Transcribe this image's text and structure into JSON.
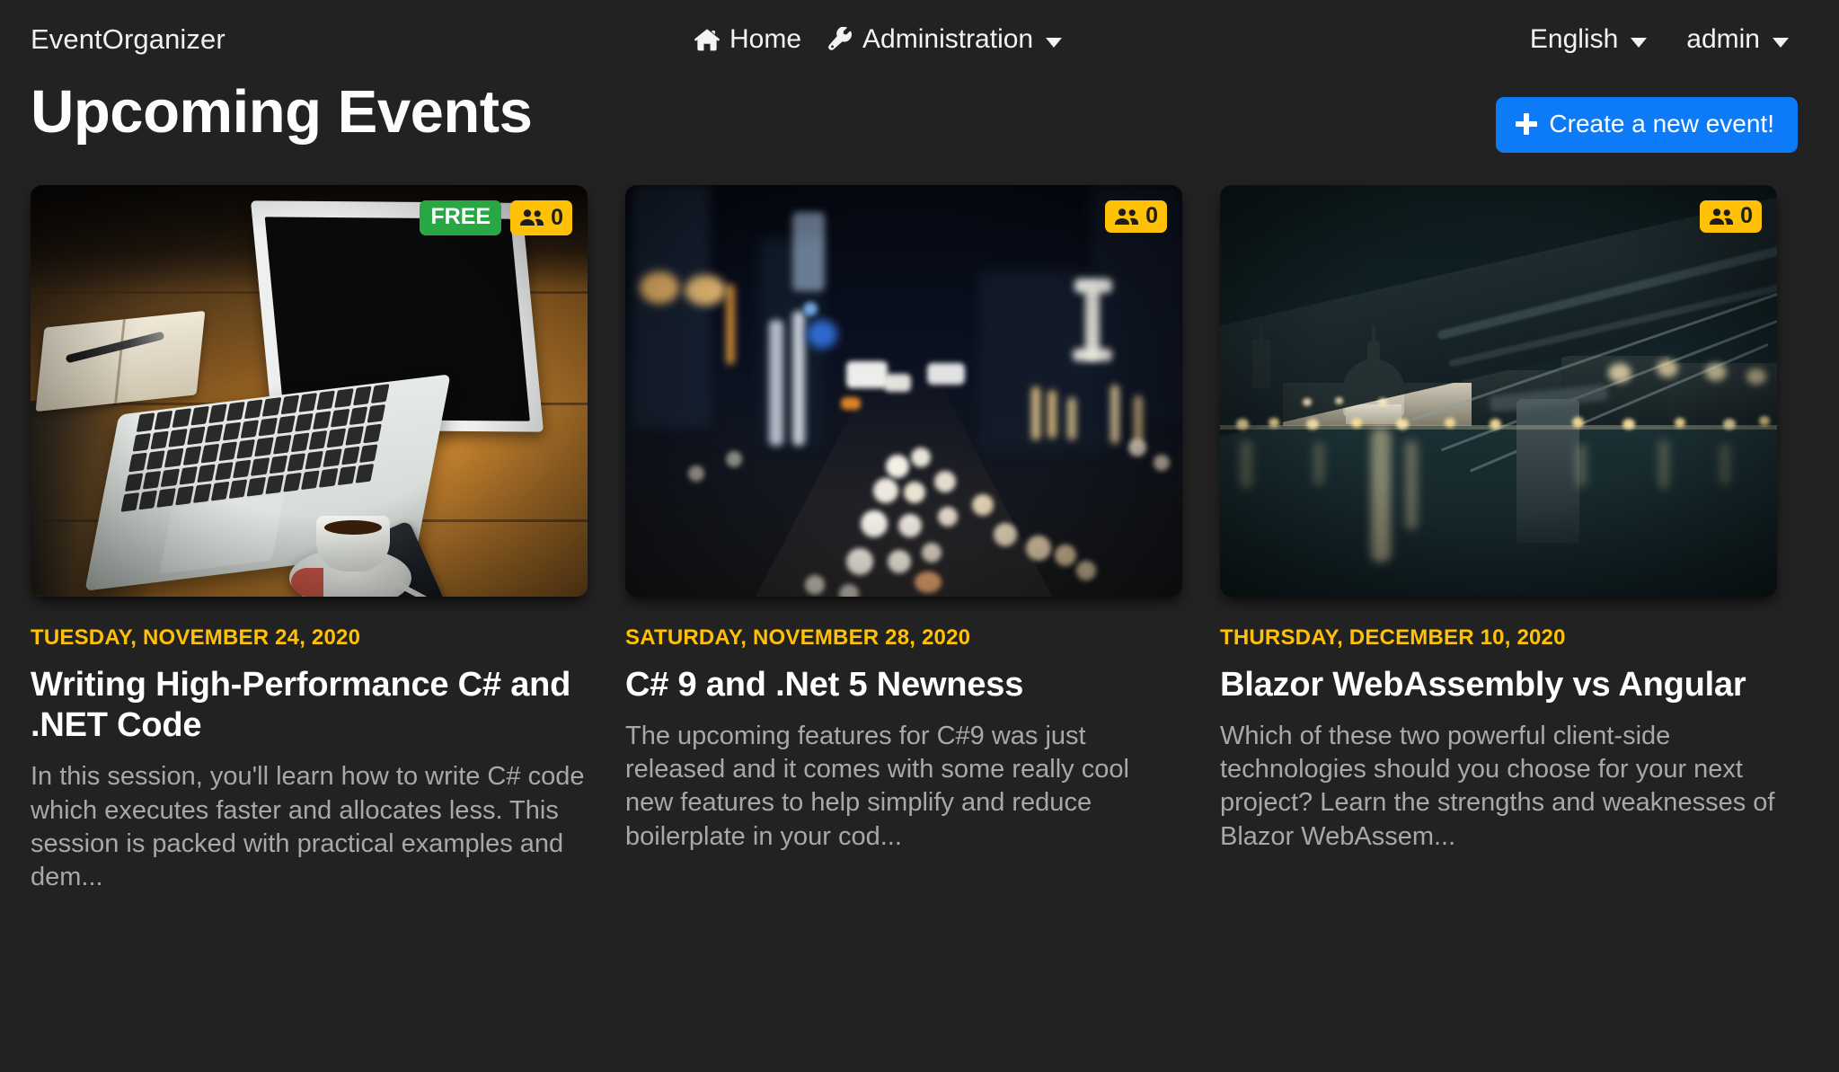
{
  "navbar": {
    "brand": "EventOrganizer",
    "home_label": "Home",
    "home_icon": "home-icon",
    "admin_label": "Administration",
    "admin_icon": "wrench-icon",
    "language_label": "English",
    "user_label": "admin"
  },
  "header": {
    "title": "Upcoming Events",
    "create_button_label": "Create a new event!",
    "create_button_icon": "plus-icon",
    "create_button_color": "#0d7bf7"
  },
  "colors": {
    "page_background": "#222222",
    "date_accent": "#ffc107",
    "free_badge": "#28a745",
    "attendee_badge": "#ffc107",
    "title_text": "#ffffff",
    "body_text": "#a8a8a8"
  },
  "events": [
    {
      "date": "TUESDAY, NOVEMBER 24, 2020",
      "title": "Writing High-Performance C# and .NET Code",
      "description": "In this session, you'll learn how to write C# code which executes faster and allocates less. This session is packed with practical examples and dem...",
      "free_badge": "FREE",
      "attendees": "0",
      "attendee_icon": "people-icon",
      "image_alt": "laptop-notebook-coffee-on-wooden-desk"
    },
    {
      "date": "SATURDAY, NOVEMBER 28, 2020",
      "title": "C# 9 and .Net 5 Newness",
      "description": "The upcoming features for C#9 was just released and it comes with some really cool new features to help simplify and reduce boilerplate in your cod...",
      "free_badge": null,
      "attendees": "0",
      "attendee_icon": "people-icon",
      "image_alt": "blurred-night-city-street-traffic-lights"
    },
    {
      "date": "THURSDAY, DECEMBER 10, 2020",
      "title": "Blazor WebAssembly vs Angular",
      "description": "Which of these two powerful client-side technologies should you choose for your next project? Learn the strengths and weaknesses of Blazor WebAssem...",
      "free_badge": null,
      "attendees": "0",
      "attendee_icon": "people-icon",
      "image_alt": "st-pauls-cathedral-millennium-bridge-at-night"
    }
  ]
}
